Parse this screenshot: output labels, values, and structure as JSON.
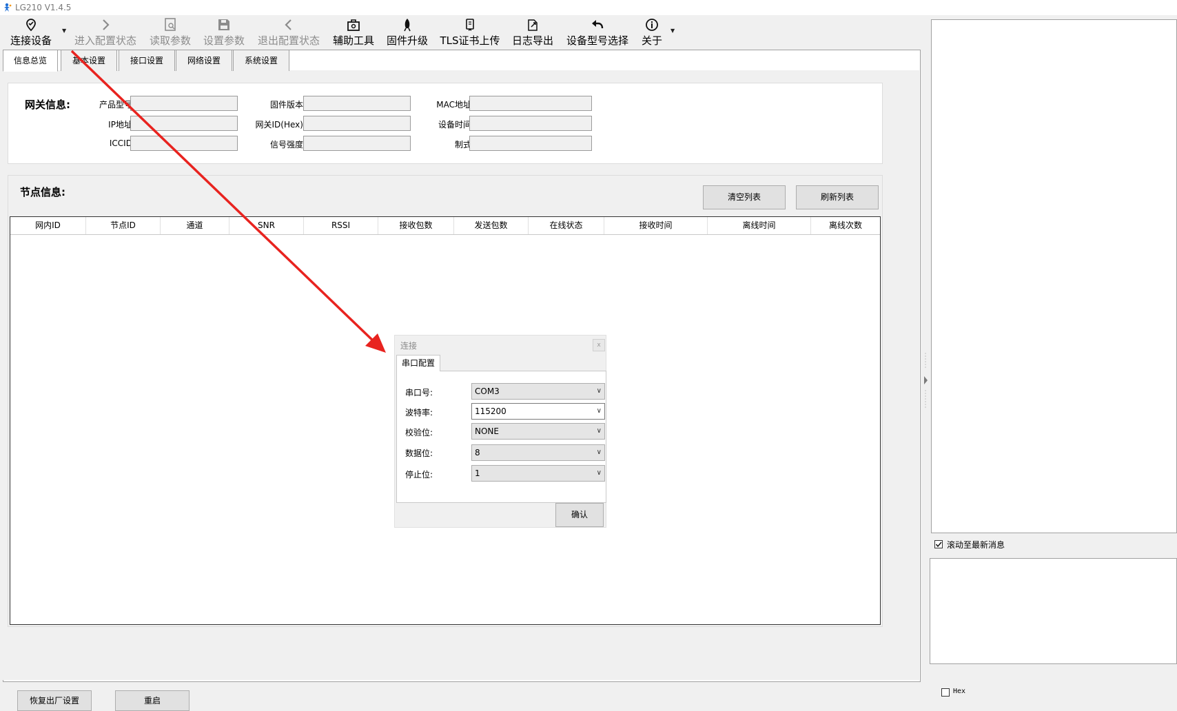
{
  "window": {
    "title": "LG210 V1.4.5"
  },
  "toolbar": {
    "items": [
      {
        "label": "连接设备",
        "icon": "location-pin-icon",
        "enabled": true
      },
      {
        "label": "进入配置状态",
        "icon": "chevron-right-icon",
        "enabled": false
      },
      {
        "label": "读取参数",
        "icon": "read-document-icon",
        "enabled": false
      },
      {
        "label": "设置参数",
        "icon": "save-disk-icon",
        "enabled": false
      },
      {
        "label": "退出配置状态",
        "icon": "chevron-left-icon",
        "enabled": false
      },
      {
        "label": "辅助工具",
        "icon": "toolbox-icon",
        "enabled": true
      },
      {
        "label": "固件升级",
        "icon": "rocket-icon",
        "enabled": true
      },
      {
        "label": "TLS证书上传",
        "icon": "certificate-upload-icon",
        "enabled": true
      },
      {
        "label": "日志导出",
        "icon": "export-icon",
        "enabled": true
      },
      {
        "label": "设备型号选择",
        "icon": "undo-arrow-icon",
        "enabled": true
      },
      {
        "label": "关于",
        "icon": "info-icon",
        "enabled": true
      }
    ]
  },
  "tabs": [
    "信息总览",
    "基本设置",
    "接口设置",
    "网络设置",
    "系统设置"
  ],
  "gateway": {
    "title": "网关信息:",
    "fields": [
      {
        "label": "产品型号:",
        "value": ""
      },
      {
        "label": "固件版本:",
        "value": ""
      },
      {
        "label": "MAC地址:",
        "value": ""
      },
      {
        "label": "IP地址:",
        "value": ""
      },
      {
        "label": "网关ID(Hex):",
        "value": ""
      },
      {
        "label": "设备时间:",
        "value": ""
      },
      {
        "label": "ICCID:",
        "value": ""
      },
      {
        "label": "信号强度:",
        "value": ""
      },
      {
        "label": "制式:",
        "value": ""
      }
    ]
  },
  "nodes": {
    "title": "节点信息:",
    "clear_label": "清空列表",
    "refresh_label": "刷新列表",
    "columns": [
      "网内ID",
      "节点ID",
      "通道",
      "SNR",
      "RSSI",
      "接收包数",
      "发送包数",
      "在线状态",
      "接收时间",
      "离线时间",
      "离线次数"
    ]
  },
  "footer": {
    "reset_label": "恢复出厂设置",
    "reboot_label": "重启"
  },
  "log": {
    "autoscroll_label": "滚动至最新消息",
    "autoscroll_checked": true,
    "hex_label": "Hex",
    "hex_checked": false
  },
  "dialog": {
    "title": "连接",
    "close": "x",
    "tab": "串口配置",
    "rows": [
      {
        "label": "串口号:",
        "value": "COM3"
      },
      {
        "label": "波特率:",
        "value": "115200"
      },
      {
        "label": "校验位:",
        "value": "NONE"
      },
      {
        "label": "数据位:",
        "value": "8"
      },
      {
        "label": "停止位:",
        "value": "1"
      }
    ],
    "confirm_label": "确认"
  },
  "colors": {
    "annotation_arrow": "#e8231f",
    "disabled_text": "#8c8c8c"
  }
}
